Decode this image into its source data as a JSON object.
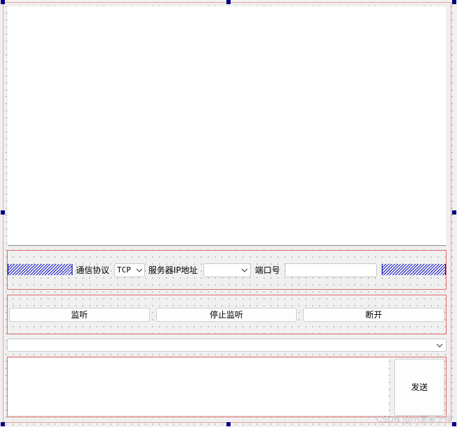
{
  "connection": {
    "protocol_label": "通信协议",
    "protocol_value": "TCP",
    "server_ip_label": "服务器IP地址",
    "server_ip_value": "",
    "port_label": "端口号",
    "port_value": ""
  },
  "actions": {
    "listen_label": "监听",
    "stop_listen_label": "停止监听",
    "disconnect_label": "断开"
  },
  "client_select": {
    "value": ""
  },
  "send": {
    "button_label": "发送",
    "text": ""
  },
  "watermark": "CSDN @小宋要上岸",
  "colors": {
    "layout_border": "#e06b6b",
    "spacer": "#1b1bd0",
    "selection_handle": "#00007f"
  }
}
